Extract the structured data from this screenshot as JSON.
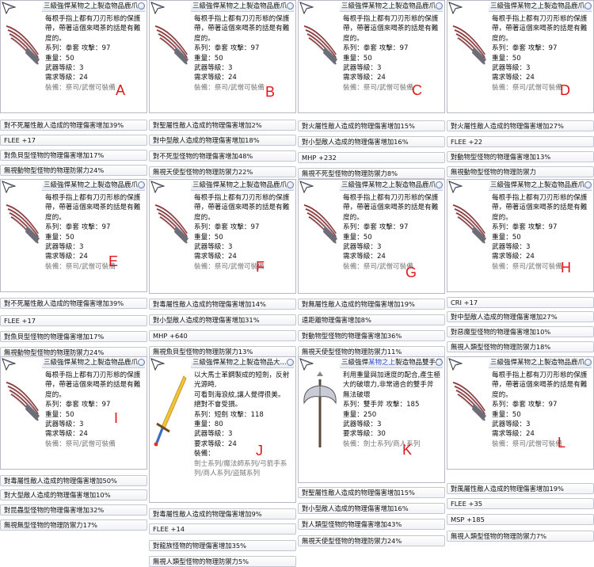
{
  "claw_item": {
    "title": "三級強悍某物之上製造物品鹿爪",
    "desc": "每根手指上都有刀刃形態的保護帶，帶著這個來喝茶的話是有難度的。",
    "stats": [
      "系列：拳套 攻擊：97",
      "重量：50",
      "武器等級：3",
      "需求等級：24"
    ],
    "equip": "裝備：祭司/武僧可裝備"
  },
  "panels": [
    {
      "letter": "A",
      "options": [
        "對不死屬性敵人造成的物理傷害增加39%",
        "FLEE +17",
        "對魚貝型怪物的物理傷害增加17%",
        "無視動物型怪物的物理防禦力24%"
      ]
    },
    {
      "letter": "B",
      "options": [
        "對聖屬性敵人造成的物理傷害增加2%",
        "對中型敵人造成的物理傷害增加18%",
        "對不死型怪物的物理傷害增加48%",
        "無視天使型怪物的物理防禦力22%"
      ]
    },
    {
      "letter": "C",
      "options": [
        "對火屬性敵人造成的物理傷害增加15%",
        "對小型敵人造成的物理傷害增加16%",
        "MHP +232",
        "無視不死型怪物的物理防禦力8%"
      ]
    },
    {
      "letter": "D",
      "options": [
        "對火屬性敵人造成的物理傷害增加27%",
        "FLEE +22",
        "對動物型怪物的物理傷害增加13%",
        "無視動物型怪物的物理防禦力"
      ]
    },
    {
      "letter": "E",
      "options": [
        "對不死屬性敵人造成的物理傷害增加39%",
        "FLEE +17",
        "對魚貝型怪物的物理傷害增加17%",
        "無視動物型怪物的物理防禦力24%"
      ]
    },
    {
      "letter": "F",
      "options": [
        "對毒屬性敵人造成的物理傷害增加14%",
        "對小型敵人造成的物理傷害增加31%",
        "MHP +640",
        "無視魚貝型怪物的物理防禦力13%"
      ]
    },
    {
      "letter": "G",
      "options": [
        "對無屬性敵人造成的物理傷害增加19%",
        "遠距離物理傷害增加8%",
        "對動物型怪物的物理傷害增加36%",
        "無視天使型怪物的物理防禦力11%"
      ]
    },
    {
      "letter": "H",
      "options": [
        "CRI +17",
        "對中型敵人造成的物理傷害增加27%",
        "對惡魔型怪物的物理傷害增加10%",
        "無視人類型怪物的物理防禦力18%"
      ]
    },
    {
      "letter": "I",
      "options": [
        "對毒屬性敵人造成的物理傷害增加50%",
        "對大型敵人造成的物理傷害增加10%",
        "對昆蟲型怪物的物理傷害增加32%",
        "無視無型怪物的物理防禦力17%"
      ]
    },
    {
      "letter": "J",
      "options": [
        "對毒屬性敵人造成的物理傷害增加9%",
        "FLEE +14",
        "對龍族怪物的物理傷害增加35%",
        "無視人類型怪物的物理防禦力5%"
      ]
    },
    {
      "letter": "K",
      "options": [
        "對聖屬性敵人造成的物理傷害增加15%",
        "對小型敵人造成的物理傷害增加16%",
        "對人類型怪物的物理傷害增加43%",
        "無視天使型怪物的物理防禦力24%"
      ]
    },
    {
      "letter": "L",
      "options": [
        "對風屬性敵人造成的物理傷害增加19%",
        "FLEE +35",
        "MSP +185",
        "無視人類型怪物的物理防禦力7%"
      ]
    }
  ],
  "sword_item": {
    "title": "三級強悍某物之上製造物品大...",
    "desc_lines": [
      "以大馬士革鋼製成的短劍，反射光源時,",
      "可看到海浪紋,讓人覺得很美。",
      "絕對不會受損。"
    ],
    "stats": [
      "系列：短劍 攻擊：118",
      "重量：80",
      "武器等級：3",
      "要求等級：24",
      "裝備："
    ],
    "equip_dim": "劍士系列/魔法師系列/弓箭手系列/商人系列/盜賊系列"
  },
  "axe_item": {
    "title_pre": "三級強悍",
    "title_hl": "某物之上",
    "title_post": "製造物品雙手斧",
    "desc": "利用重量與加速度的配合,產生極大的破壞力,非常適合的雙手斧",
    "extra": "無法破壞",
    "stats": [
      "系列：雙手斧 攻擊：185",
      "重量：250",
      "武器等級：3",
      "要求等級：30"
    ],
    "equip_dim": "裝備：劍士系列/商人系列"
  },
  "colors": {
    "letter": "#e2151b",
    "title_highlight": "#2a49c8"
  }
}
